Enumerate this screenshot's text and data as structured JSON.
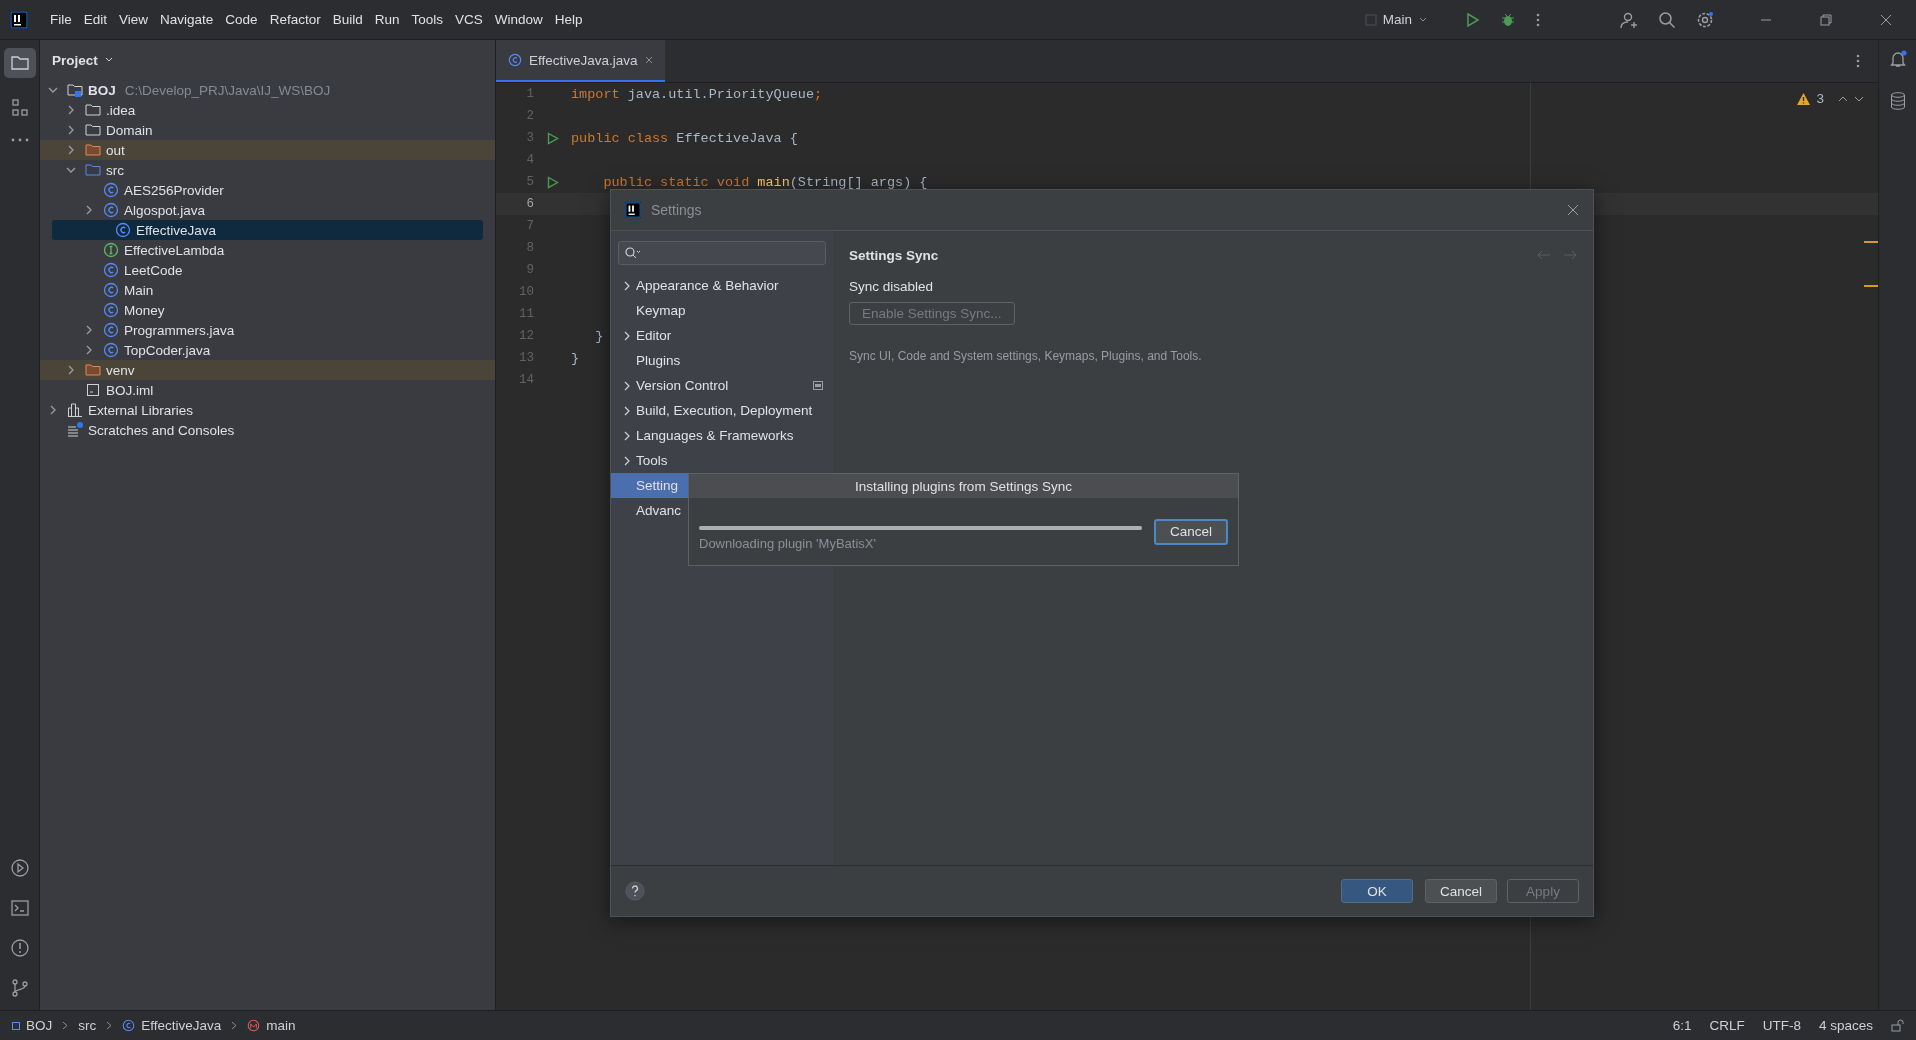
{
  "menu": [
    "File",
    "Edit",
    "View",
    "Navigate",
    "Code",
    "Refactor",
    "Build",
    "Run",
    "Tools",
    "VCS",
    "Window",
    "Help"
  ],
  "toolbar": {
    "run_config": "Main"
  },
  "project_panel": {
    "title": "Project",
    "tree": [
      {
        "label": "BOJ",
        "path": "C:\\Develop_PRJ\\Java\\IJ_WS\\BOJ",
        "kind": "module",
        "expanded": true,
        "selected": false,
        "children": [
          {
            "label": ".idea",
            "kind": "folder",
            "expanded": false,
            "selected": false
          },
          {
            "label": "Domain",
            "kind": "folder",
            "expanded": false,
            "selected": false
          },
          {
            "label": "out",
            "kind": "excluded",
            "expanded": false,
            "selected": false
          },
          {
            "label": "src",
            "kind": "source",
            "expanded": true,
            "selected": false,
            "children": [
              {
                "label": "AES256Provider",
                "kind": "class",
                "selected": false
              },
              {
                "label": "Algospot.java",
                "kind": "class",
                "expanded": false,
                "selected": false
              },
              {
                "label": "EffectiveJava",
                "kind": "class",
                "selected": true
              },
              {
                "label": "EffectiveLambda",
                "kind": "interface",
                "selected": false
              },
              {
                "label": "LeetCode",
                "kind": "class",
                "selected": false
              },
              {
                "label": "Main",
                "kind": "class",
                "selected": false
              },
              {
                "label": "Money",
                "kind": "class",
                "selected": false
              },
              {
                "label": "Programmers.java",
                "kind": "class",
                "expanded": false,
                "selected": false
              },
              {
                "label": "TopCoder.java",
                "kind": "class",
                "expanded": false,
                "selected": false
              }
            ]
          },
          {
            "label": "venv",
            "kind": "excluded",
            "expanded": false,
            "selected": false
          },
          {
            "label": "BOJ.iml",
            "kind": "file",
            "selected": false
          }
        ]
      },
      {
        "label": "External Libraries",
        "kind": "libraries",
        "expanded": false,
        "selected": false
      },
      {
        "label": "Scratches and Consoles",
        "kind": "scratches",
        "selected": false
      }
    ]
  },
  "editor": {
    "tabs": [
      {
        "label": "EffectiveJava.java",
        "selected": true
      }
    ],
    "warnings": "3",
    "lines": [
      {
        "number": "1",
        "run": false,
        "current": false,
        "tokens": [
          {
            "t": "import",
            "kind": "keyword"
          },
          {
            "t": " java.util.PriorityQueue",
            "kind": "plain"
          },
          {
            "t": ";",
            "kind": "keyword"
          }
        ]
      },
      {
        "number": "2",
        "run": false,
        "current": false
      },
      {
        "number": "3",
        "run": true,
        "current": false,
        "tokens": [
          {
            "t": "public class",
            "kind": "keyword"
          },
          {
            "t": " EffectiveJava {",
            "kind": "plain"
          }
        ]
      },
      {
        "number": "4",
        "run": false,
        "current": false
      },
      {
        "number": "5",
        "run": true,
        "current": false,
        "tokens": [
          {
            "t": "    public static void ",
            "kind": "keyword"
          },
          {
            "t": "main",
            "kind": "method"
          },
          {
            "t": "(String[] args) {",
            "kind": "plain"
          }
        ]
      },
      {
        "number": "6",
        "run": false,
        "current": true
      },
      {
        "number": "7",
        "run": false,
        "current": false
      },
      {
        "number": "8",
        "run": false,
        "current": false
      },
      {
        "number": "9",
        "run": false,
        "current": false
      },
      {
        "number": "10",
        "run": false,
        "current": false
      },
      {
        "number": "11",
        "run": false,
        "current": false
      },
      {
        "number": "12",
        "run": false,
        "current": false,
        "tokens": [
          {
            "t": "   }",
            "kind": "plain"
          }
        ]
      },
      {
        "number": "13",
        "run": false,
        "current": false,
        "tokens": [
          {
            "t": "}",
            "kind": "plain"
          }
        ]
      },
      {
        "number": "14",
        "run": false,
        "current": false
      }
    ]
  },
  "settings": {
    "title": "Settings",
    "nav": [
      {
        "label": "Appearance & Behavior",
        "expanded": false,
        "selected": false
      },
      {
        "label": "Keymap",
        "selected": false
      },
      {
        "label": "Editor",
        "expanded": false,
        "selected": false
      },
      {
        "label": "Plugins",
        "selected": false
      },
      {
        "label": "Version Control",
        "expanded": false,
        "selected": false,
        "marker": true
      },
      {
        "label": "Build, Execution, Deployment",
        "expanded": false,
        "selected": false
      },
      {
        "label": "Languages & Frameworks",
        "expanded": false,
        "selected": false
      },
      {
        "label": "Tools",
        "expanded": false,
        "selected": false
      },
      {
        "label": "Setting",
        "selected": true
      },
      {
        "label": "Advanc",
        "selected": false
      }
    ],
    "page": {
      "title": "Settings Sync",
      "status": "Sync disabled",
      "button": {
        "label": "Enable Settings Sync...",
        "disabled": true
      },
      "description": "Sync UI, Code and System settings, Keymaps, Plugins, and Tools."
    },
    "buttons": [
      {
        "label": "OK",
        "kind": "primary",
        "disabled": false
      },
      {
        "label": "Cancel",
        "kind": "normal",
        "disabled": false
      },
      {
        "label": "Apply",
        "kind": "normal",
        "disabled": true
      }
    ]
  },
  "progress_popup": {
    "title": "Installing plugins from Settings Sync",
    "level": 1,
    "status": "Downloading plugin 'MyBatisX'",
    "button": "Cancel"
  },
  "status_bar": {
    "breadcrumbs": [
      {
        "label": "BOJ",
        "kind": "module"
      },
      {
        "label": "src",
        "kind": "folder"
      },
      {
        "label": "EffectiveJava",
        "kind": "class"
      },
      {
        "label": "main",
        "kind": "method"
      }
    ],
    "items": [
      "6:1",
      "CRLF",
      "UTF-8",
      "4 spaces"
    ]
  }
}
